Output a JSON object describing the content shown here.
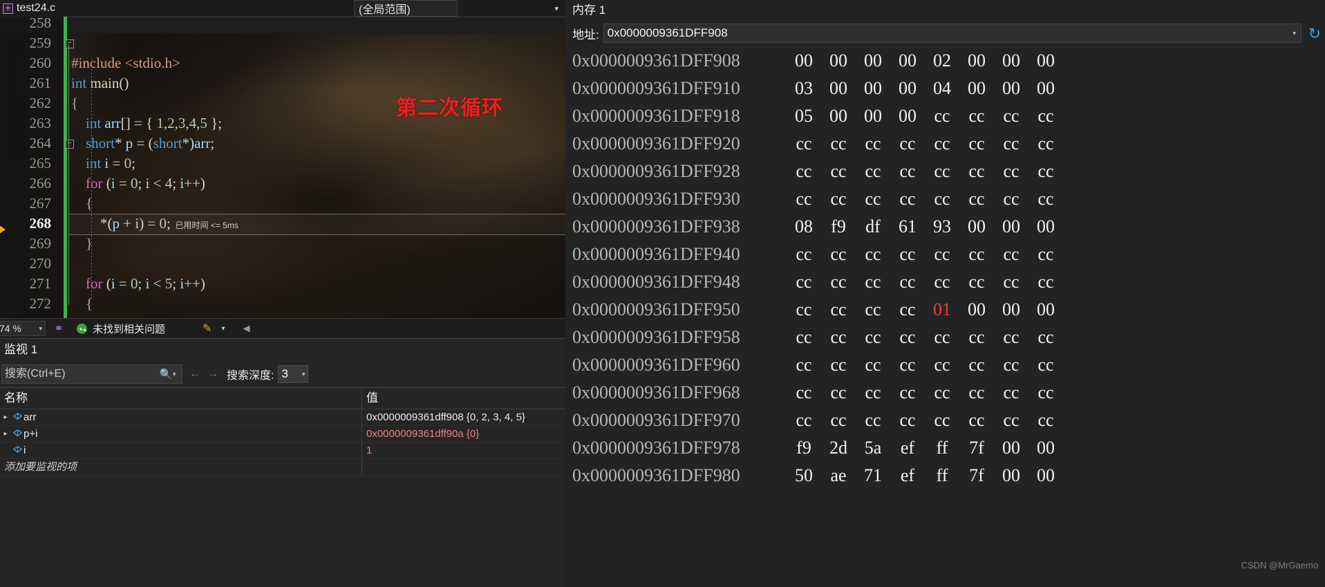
{
  "editor": {
    "tab_label": "test24.c",
    "tab_caret": "▾",
    "scope_label": "(全局范围)",
    "annotation": "第二次循环",
    "elapsed_label": "已用时间 <= 5ms",
    "current_line": 268,
    "lines": [
      {
        "num": "258",
        "tokens": []
      },
      {
        "num": "259",
        "tokens": []
      },
      {
        "num": "260",
        "tokens": [
          {
            "t": "#include ",
            "c": "k-pre"
          },
          {
            "t": "<stdio.h>",
            "c": "k-str"
          }
        ]
      },
      {
        "num": "261",
        "tokens": [
          {
            "t": "int ",
            "c": "k-type"
          },
          {
            "t": "main",
            "c": "k-fn"
          },
          {
            "t": "()",
            "c": "k-pun"
          }
        ]
      },
      {
        "num": "262",
        "tokens": [
          {
            "t": "{",
            "c": "k-br"
          }
        ]
      },
      {
        "num": "263",
        "tokens": [
          {
            "t": "    ",
            "c": "k-plain"
          },
          {
            "t": "int ",
            "c": "k-type"
          },
          {
            "t": "arr",
            "c": "k-id"
          },
          {
            "t": "[] = { ",
            "c": "k-pun"
          },
          {
            "t": "1,2,3,4,5",
            "c": "k-num"
          },
          {
            "t": " };",
            "c": "k-pun"
          }
        ]
      },
      {
        "num": "264",
        "tokens": [
          {
            "t": "    ",
            "c": "k-plain"
          },
          {
            "t": "short",
            "c": "k-type"
          },
          {
            "t": "* ",
            "c": "k-pun"
          },
          {
            "t": "p",
            "c": "k-id"
          },
          {
            "t": " = (",
            "c": "k-pun"
          },
          {
            "t": "short",
            "c": "k-type"
          },
          {
            "t": "*)",
            "c": "k-pun"
          },
          {
            "t": "arr",
            "c": "k-id"
          },
          {
            "t": ";",
            "c": "k-pun"
          }
        ]
      },
      {
        "num": "265",
        "tokens": [
          {
            "t": "    ",
            "c": "k-plain"
          },
          {
            "t": "int ",
            "c": "k-type"
          },
          {
            "t": "i",
            "c": "k-id"
          },
          {
            "t": " = ",
            "c": "k-pun"
          },
          {
            "t": "0",
            "c": "k-num"
          },
          {
            "t": ";",
            "c": "k-pun"
          }
        ]
      },
      {
        "num": "266",
        "tokens": [
          {
            "t": "    ",
            "c": "k-plain"
          },
          {
            "t": "for",
            "c": "k-kw"
          },
          {
            "t": " (",
            "c": "k-pun"
          },
          {
            "t": "i",
            "c": "k-id"
          },
          {
            "t": " = ",
            "c": "k-pun"
          },
          {
            "t": "0",
            "c": "k-num"
          },
          {
            "t": "; ",
            "c": "k-pun"
          },
          {
            "t": "i",
            "c": "k-id"
          },
          {
            "t": " < ",
            "c": "k-pun"
          },
          {
            "t": "4",
            "c": "k-num"
          },
          {
            "t": "; ",
            "c": "k-pun"
          },
          {
            "t": "i",
            "c": "k-id"
          },
          {
            "t": "++)",
            "c": "k-pun"
          }
        ]
      },
      {
        "num": "267",
        "tokens": [
          {
            "t": "    {",
            "c": "k-br"
          }
        ]
      },
      {
        "num": "268",
        "tokens": [
          {
            "t": "        *(",
            "c": "k-pun"
          },
          {
            "t": "p",
            "c": "k-id"
          },
          {
            "t": " + ",
            "c": "k-pun"
          },
          {
            "t": "i",
            "c": "k-id"
          },
          {
            "t": ") = ",
            "c": "k-pun"
          },
          {
            "t": "0",
            "c": "k-num"
          },
          {
            "t": ";",
            "c": "k-pun"
          }
        ]
      },
      {
        "num": "269",
        "tokens": [
          {
            "t": "    }",
            "c": "k-br"
          }
        ]
      },
      {
        "num": "270",
        "tokens": []
      },
      {
        "num": "271",
        "tokens": [
          {
            "t": "    ",
            "c": "k-plain"
          },
          {
            "t": "for",
            "c": "k-kw"
          },
          {
            "t": " (",
            "c": "k-pun"
          },
          {
            "t": "i",
            "c": "k-id"
          },
          {
            "t": " = ",
            "c": "k-pun"
          },
          {
            "t": "0",
            "c": "k-num"
          },
          {
            "t": "; ",
            "c": "k-pun"
          },
          {
            "t": "i",
            "c": "k-id"
          },
          {
            "t": " < ",
            "c": "k-pun"
          },
          {
            "t": "5",
            "c": "k-num"
          },
          {
            "t": "; ",
            "c": "k-pun"
          },
          {
            "t": "i",
            "c": "k-id"
          },
          {
            "t": "++)",
            "c": "k-pun"
          }
        ]
      },
      {
        "num": "272",
        "tokens": [
          {
            "t": "    {",
            "c": "k-br"
          }
        ]
      }
    ]
  },
  "editor_status": {
    "zoom_value": "74 %",
    "issue_text": "未找到相关问题",
    "tool_icon": "quick-action-icon",
    "pencil_icon": "pencil-icon",
    "left_caret": "◀"
  },
  "watch": {
    "title": "监视 1",
    "search_placeholder": "搜索(Ctrl+E)",
    "search_value": "",
    "depth_label": "搜索深度:",
    "depth_value": "3",
    "nav_back": "←",
    "nav_forward": "→",
    "columns": [
      "名称",
      "值"
    ],
    "rows": [
      {
        "expander": "▸",
        "name": "arr",
        "value": "0x0000009361dff908 {0, 2, 3, 4, 5}",
        "value_color": "val-white"
      },
      {
        "expander": "▸",
        "name": "p+i",
        "value": "0x0000009361dff90a {0}",
        "value_color": "val-red"
      },
      {
        "expander": "",
        "name": "i",
        "value": "1",
        "value_color": "val-red"
      }
    ],
    "add_item_placeholder": "添加要监视的项"
  },
  "memory": {
    "title": "内存 1",
    "address_label": "地址:",
    "address_value": "0x0000009361DFF908",
    "refresh_icon": "refresh-icon",
    "rows": [
      {
        "address": "0x0000009361DFF908",
        "bytes": [
          "00",
          "00",
          "00",
          "00",
          "02",
          "00",
          "00",
          "00"
        ],
        "red": []
      },
      {
        "address": "0x0000009361DFF910",
        "bytes": [
          "03",
          "00",
          "00",
          "00",
          "04",
          "00",
          "00",
          "00"
        ],
        "red": []
      },
      {
        "address": "0x0000009361DFF918",
        "bytes": [
          "05",
          "00",
          "00",
          "00",
          "cc",
          "cc",
          "cc",
          "cc"
        ],
        "red": []
      },
      {
        "address": "0x0000009361DFF920",
        "bytes": [
          "cc",
          "cc",
          "cc",
          "cc",
          "cc",
          "cc",
          "cc",
          "cc"
        ],
        "red": []
      },
      {
        "address": "0x0000009361DFF928",
        "bytes": [
          "cc",
          "cc",
          "cc",
          "cc",
          "cc",
          "cc",
          "cc",
          "cc"
        ],
        "red": []
      },
      {
        "address": "0x0000009361DFF930",
        "bytes": [
          "cc",
          "cc",
          "cc",
          "cc",
          "cc",
          "cc",
          "cc",
          "cc"
        ],
        "red": []
      },
      {
        "address": "0x0000009361DFF938",
        "bytes": [
          "08",
          "f9",
          "df",
          "61",
          "93",
          "00",
          "00",
          "00"
        ],
        "red": []
      },
      {
        "address": "0x0000009361DFF940",
        "bytes": [
          "cc",
          "cc",
          "cc",
          "cc",
          "cc",
          "cc",
          "cc",
          "cc"
        ],
        "red": []
      },
      {
        "address": "0x0000009361DFF948",
        "bytes": [
          "cc",
          "cc",
          "cc",
          "cc",
          "cc",
          "cc",
          "cc",
          "cc"
        ],
        "red": []
      },
      {
        "address": "0x0000009361DFF950",
        "bytes": [
          "cc",
          "cc",
          "cc",
          "cc",
          "01",
          "00",
          "00",
          "00"
        ],
        "red": [
          4
        ]
      },
      {
        "address": "0x0000009361DFF958",
        "bytes": [
          "cc",
          "cc",
          "cc",
          "cc",
          "cc",
          "cc",
          "cc",
          "cc"
        ],
        "red": []
      },
      {
        "address": "0x0000009361DFF960",
        "bytes": [
          "cc",
          "cc",
          "cc",
          "cc",
          "cc",
          "cc",
          "cc",
          "cc"
        ],
        "red": []
      },
      {
        "address": "0x0000009361DFF968",
        "bytes": [
          "cc",
          "cc",
          "cc",
          "cc",
          "cc",
          "cc",
          "cc",
          "cc"
        ],
        "red": []
      },
      {
        "address": "0x0000009361DFF970",
        "bytes": [
          "cc",
          "cc",
          "cc",
          "cc",
          "cc",
          "cc",
          "cc",
          "cc"
        ],
        "red": []
      },
      {
        "address": "0x0000009361DFF978",
        "bytes": [
          "f9",
          "2d",
          "5a",
          "ef",
          "ff",
          "7f",
          "00",
          "00"
        ],
        "red": []
      },
      {
        "address": "0x0000009361DFF980",
        "bytes": [
          "50",
          "ae",
          "71",
          "ef",
          "ff",
          "7f",
          "00",
          "00"
        ],
        "red": []
      }
    ],
    "circle_annotation": "red-circle-around-bytes-3-and-4"
  },
  "watermark": "CSDN @MrGaemo",
  "colors": {
    "accent_green": "#3fb24a",
    "annotation_red": "#f01d1d",
    "highlight_red": "#e8413a",
    "watch_red": "#e9837c"
  }
}
